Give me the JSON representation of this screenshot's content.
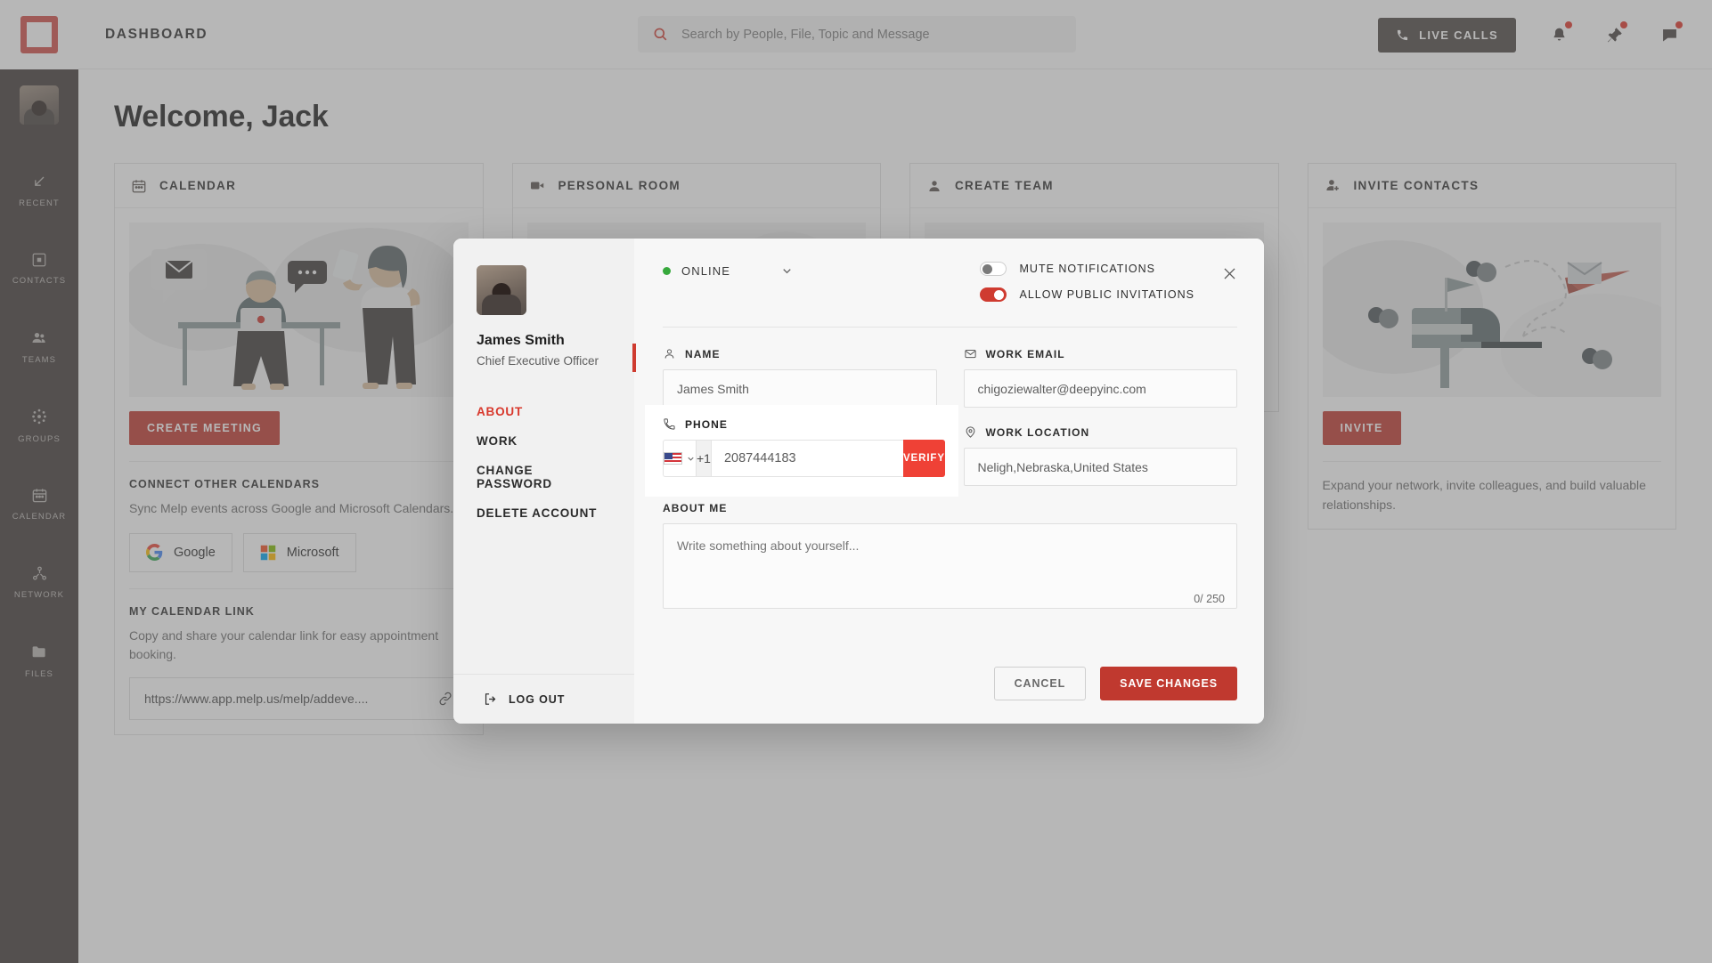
{
  "topbar": {
    "title": "DASHBOARD",
    "search_placeholder": "Search by People, File, Topic and Message",
    "live_calls_label": "LIVE CALLS",
    "icons": [
      "bell-icon",
      "pin-icon",
      "chat-icon"
    ]
  },
  "rail": {
    "items": [
      {
        "label": "RECENT",
        "icon": "arrow-down-left-icon"
      },
      {
        "label": "CONTACTS",
        "icon": "contact-card-icon"
      },
      {
        "label": "TEAMS",
        "icon": "people-icon"
      },
      {
        "label": "GROUPS",
        "icon": "groups-dots-icon"
      },
      {
        "label": "CALENDAR",
        "icon": "calendar-icon"
      },
      {
        "label": "NETWORK",
        "icon": "network-icon"
      },
      {
        "label": "FILES",
        "icon": "folder-icon"
      }
    ]
  },
  "main": {
    "welcome": "Welcome, Jack",
    "cards": [
      {
        "title": "CALENDAR",
        "icon": "calendar-icon",
        "button": "CREATE MEETING",
        "connect_title": "CONNECT OTHER CALENDARS",
        "connect_text": "Sync Melp events across Google and Microsoft Calendars.",
        "providers": [
          "Google",
          "Microsoft"
        ],
        "link_title": "MY CALENDAR LINK",
        "link_text": "Copy and share your calendar link for easy appointment booking.",
        "link_url": "https://www.app.melp.us/melp/addeve...."
      },
      {
        "title": "PERSONAL ROOM",
        "icon": "video-camera-icon"
      },
      {
        "title": "CREATE TEAM",
        "icon": "people-icon"
      },
      {
        "title": "INVITE CONTACTS",
        "icon": "add-person-icon",
        "button": "INVITE",
        "footer": "Expand your network, invite colleagues, and build valuable relationships."
      }
    ]
  },
  "modal": {
    "profile": {
      "name": "James Smith",
      "role": "Chief Executive Officer"
    },
    "nav": [
      {
        "label": "ABOUT",
        "active": true
      },
      {
        "label": "WORK",
        "active": false
      },
      {
        "label": "CHANGE PASSWORD",
        "active": false
      },
      {
        "label": "DELETE ACCOUNT",
        "active": false
      }
    ],
    "logout_label": "LOG OUT",
    "status": {
      "label": "ONLINE",
      "color": "#37a93c"
    },
    "toggles": [
      {
        "label": "MUTE NOTIFICATIONS",
        "on": false
      },
      {
        "label": "ALLOW PUBLIC INVITATIONS",
        "on": true
      }
    ],
    "close_icon": "close-icon",
    "fields": {
      "name_label": "NAME",
      "name_value": "James Smith",
      "email_label": "WORK EMAIL",
      "email_value": "chigoziewalter@deepyinc.com",
      "phone_label": "PHONE",
      "phone_country_code": "+1",
      "phone_value": "2087444183",
      "phone_verify_label": "VERIFY",
      "phone_flag": "us-flag-icon",
      "location_label": "WORK LOCATION",
      "location_value": "Neligh,Nebraska,United States",
      "about_label": "ABOUT ME",
      "about_placeholder": "Write something about yourself...",
      "about_counter": "0/ 250"
    },
    "actions": {
      "cancel": "CANCEL",
      "save": "SAVE CHANGES"
    }
  },
  "colors": {
    "brand_red": "#c0392f",
    "verify_red": "#ef4136",
    "accent_red": "#cf3b30",
    "rail_dark": "#413b39",
    "online_green": "#37a93c"
  }
}
